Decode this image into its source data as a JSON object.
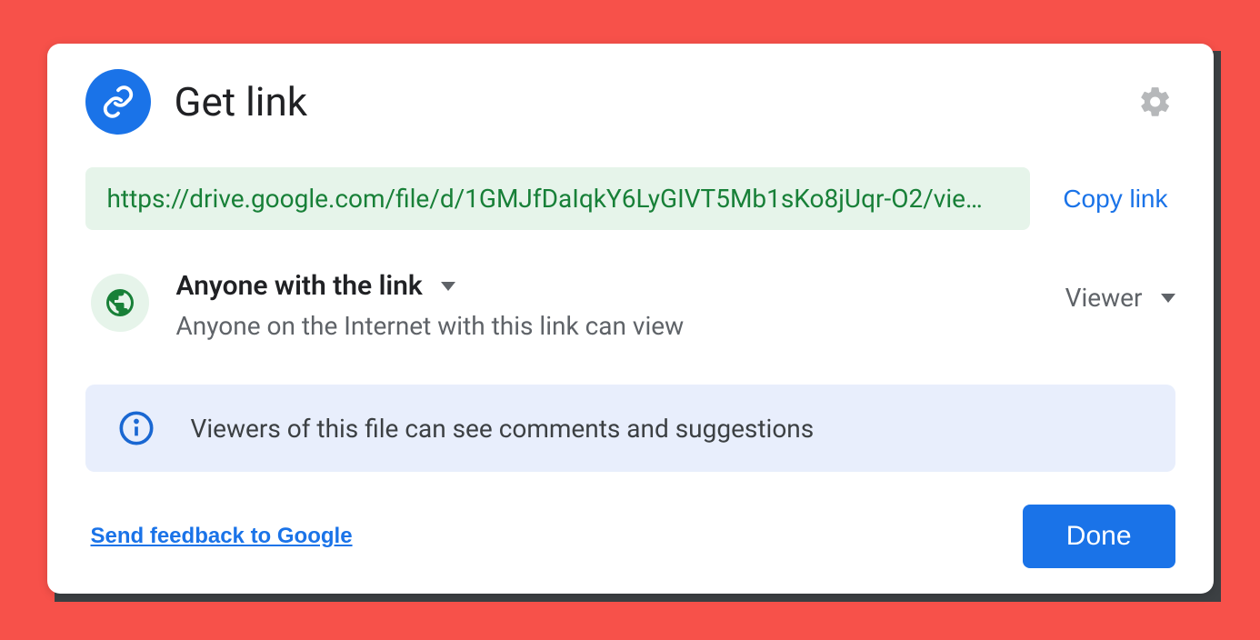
{
  "dialog": {
    "title": "Get link",
    "url": "https://drive.google.com/file/d/1GMJfDaIqkY6LyGIVT5Mb1sKo8jUqr-O2/vie…",
    "copy_label": "Copy link",
    "access": {
      "scope_label": "Anyone with the link",
      "scope_desc": "Anyone on the Internet with this link can view",
      "role_label": "Viewer"
    },
    "info_text": "Viewers of this file can see comments and suggestions",
    "feedback_label": "Send feedback to Google",
    "done_label": "Done"
  }
}
